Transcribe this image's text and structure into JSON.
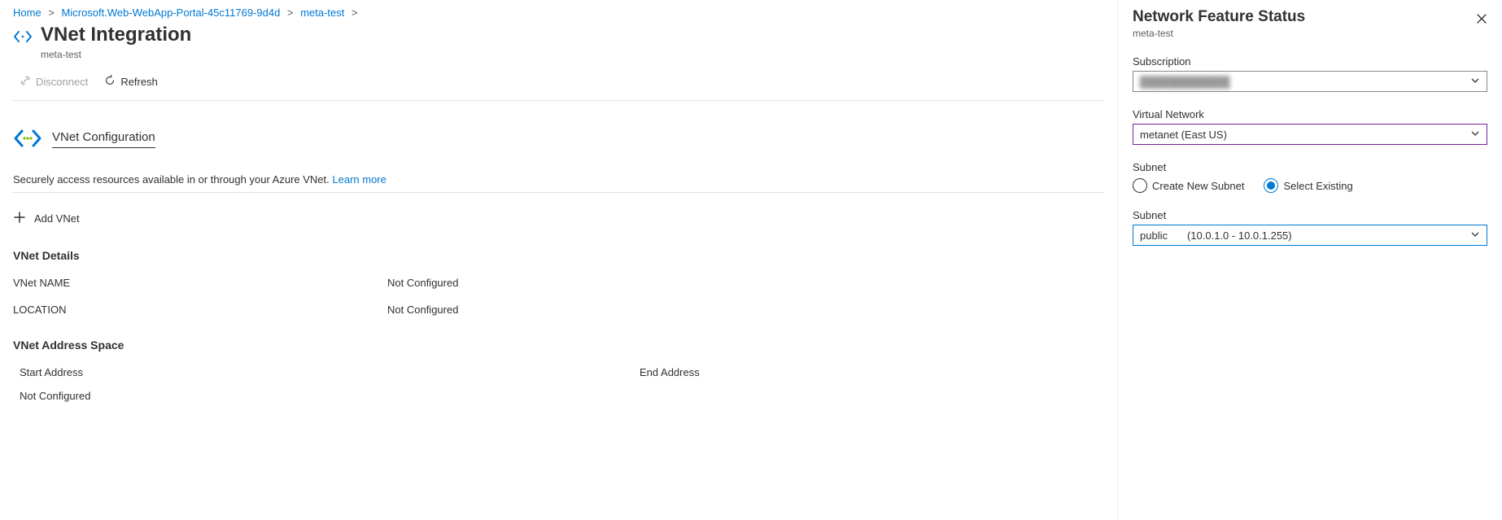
{
  "breadcrumb": {
    "home": "Home",
    "resource": "Microsoft.Web-WebApp-Portal-45c11769-9d4d",
    "app": "meta-test"
  },
  "page": {
    "title": "VNet Integration",
    "subtitle": "meta-test"
  },
  "toolbar": {
    "disconnect": "Disconnect",
    "refresh": "Refresh"
  },
  "config": {
    "section_title": "VNet Configuration",
    "description": "Securely access resources available in or through your Azure VNet.",
    "learn_more": "Learn more",
    "add_vnet": "Add VNet"
  },
  "details": {
    "heading": "VNet Details",
    "name_label": "VNet NAME",
    "name_value": "Not Configured",
    "location_label": "LOCATION",
    "location_value": "Not Configured"
  },
  "address_space": {
    "heading": "VNet Address Space",
    "col_start": "Start Address",
    "col_end": "End Address",
    "row0": "Not Configured"
  },
  "panel": {
    "title": "Network Feature Status",
    "subtitle": "meta-test",
    "subscription_label": "Subscription",
    "subscription_value": "████████████",
    "vnet_label": "Virtual Network",
    "vnet_value": "metanet (East US)",
    "subnet_type_label": "Subnet",
    "opt_create": "Create New Subnet",
    "opt_existing": "Select Existing",
    "subnet_label": "Subnet",
    "subnet_name": "public",
    "subnet_range": "(10.0.1.0 - 10.0.1.255)"
  }
}
